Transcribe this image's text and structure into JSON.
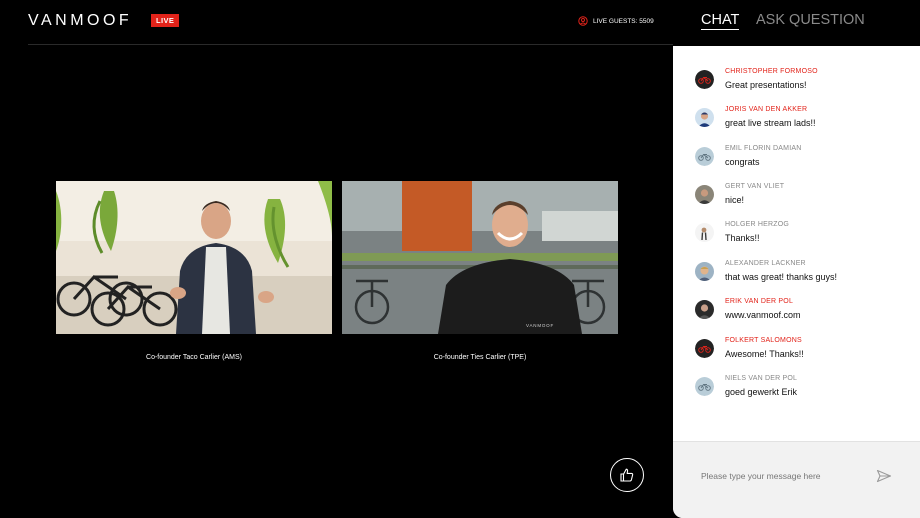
{
  "header": {
    "logo": "VANMOOF",
    "live_badge": "LIVE",
    "live_guests": "LIVE GUESTS: 5509",
    "guests_icon": "user-circle-icon"
  },
  "stage": {
    "feeds": [
      {
        "caption": "Co-founder Taco Carlier (AMS)"
      },
      {
        "caption": "Co-founder Ties Carlier (TPE)"
      }
    ],
    "like_icon": "thumbs-up-icon"
  },
  "panel": {
    "tabs": [
      {
        "label": "CHAT",
        "active": true
      },
      {
        "label": "ASK QUESTION",
        "active": false
      }
    ],
    "messages": [
      {
        "name": "CHRISTOPHER FORMOSO",
        "text": "Great presentations!",
        "name_color": "#e2231a",
        "avatar": "bike-logo-dark"
      },
      {
        "name": "JORIS VAN DEN AKKER",
        "text": "great live stream lads!!",
        "name_color": "#e2231a",
        "avatar": "photo"
      },
      {
        "name": "EMIL FLORIN DAMIAN",
        "text": "congrats",
        "name_color": "#888888",
        "avatar": "bike-logo-light"
      },
      {
        "name": "GERT VAN VLIET",
        "text": "nice!",
        "name_color": "#888888",
        "avatar": "photo"
      },
      {
        "name": "HOLGER HERZOG",
        "text": "Thanks!!",
        "name_color": "#888888",
        "avatar": "photo"
      },
      {
        "name": "ALEXANDER LACKNER",
        "text": "that was great! thanks guys!",
        "name_color": "#888888",
        "avatar": "photo"
      },
      {
        "name": "ERIK VAN DER POL",
        "text": "www.vanmoof.com",
        "name_color": "#e2231a",
        "avatar": "photo"
      },
      {
        "name": "FOLKERT SALOMONS",
        "text": "Awesome! Thanks!!",
        "name_color": "#e2231a",
        "avatar": "bike-logo-dark"
      },
      {
        "name": "NIELS VAN DER POL",
        "text": "goed gewerkt Erik",
        "name_color": "#888888",
        "avatar": "bike-logo-light"
      }
    ],
    "composer": {
      "placeholder": "Please type your message here",
      "send_icon": "send-icon"
    }
  },
  "colors": {
    "accent_red": "#e2231a",
    "stage_bg": "#000000",
    "panel_bg": "#ffffff"
  }
}
